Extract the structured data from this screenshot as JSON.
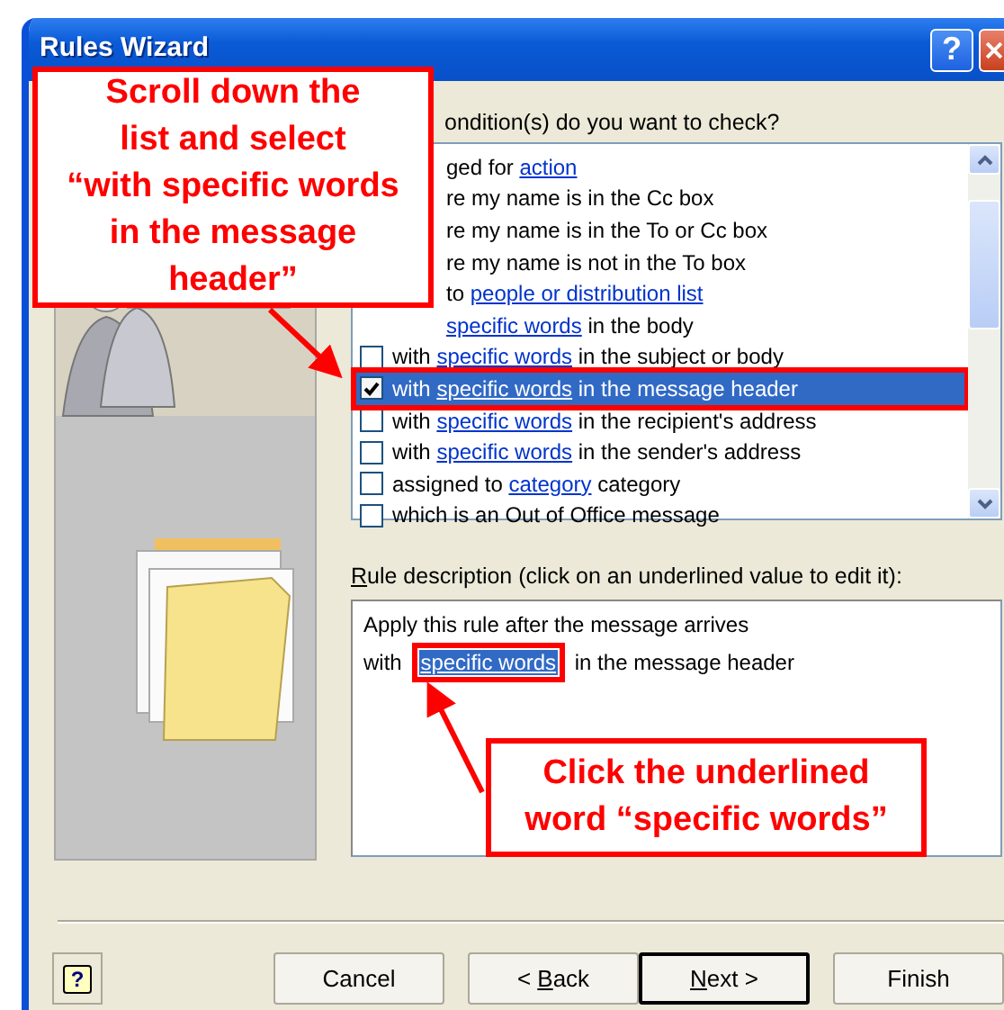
{
  "window": {
    "title": "Rules Wizard",
    "help_glyph": "?"
  },
  "conditions": {
    "label": "ondition(s) do you want to check?",
    "rows": [
      {
        "covered": true,
        "selected": false,
        "annotated": false,
        "segments": [
          {
            "text": "ged for "
          },
          {
            "text": "action",
            "link": true
          }
        ]
      },
      {
        "covered": true,
        "selected": false,
        "annotated": false,
        "segments": [
          {
            "text": "re my name is in the Cc box"
          }
        ]
      },
      {
        "covered": true,
        "selected": false,
        "annotated": false,
        "segments": [
          {
            "text": "re my name is in the To or Cc box"
          }
        ]
      },
      {
        "covered": true,
        "selected": false,
        "annotated": false,
        "segments": [
          {
            "text": "re my name is not in the To box"
          }
        ]
      },
      {
        "covered": true,
        "selected": false,
        "annotated": false,
        "segments": [
          {
            "text": "to "
          },
          {
            "text": "people or distribution list",
            "link": true
          }
        ]
      },
      {
        "covered": true,
        "selected": false,
        "annotated": false,
        "segments": [
          {
            "text": "specific words",
            "link": true
          },
          {
            "text": " in the body"
          }
        ]
      },
      {
        "covered": false,
        "checked": false,
        "selected": false,
        "annotated": false,
        "segments": [
          {
            "text": "with "
          },
          {
            "text": "specific words",
            "link": true
          },
          {
            "text": " in the subject or body"
          }
        ]
      },
      {
        "covered": false,
        "checked": true,
        "selected": true,
        "annotated": true,
        "segments": [
          {
            "text": "with "
          },
          {
            "text": "specific words",
            "link": true
          },
          {
            "text": " in the message header"
          }
        ]
      },
      {
        "covered": false,
        "checked": false,
        "selected": false,
        "annotated": false,
        "segments": [
          {
            "text": "with "
          },
          {
            "text": "specific words",
            "link": true
          },
          {
            "text": " in the recipient's address"
          }
        ]
      },
      {
        "covered": false,
        "checked": false,
        "selected": false,
        "annotated": false,
        "segments": [
          {
            "text": "with "
          },
          {
            "text": "specific words",
            "link": true
          },
          {
            "text": " in the sender's address"
          }
        ]
      },
      {
        "covered": false,
        "checked": false,
        "selected": false,
        "annotated": false,
        "segments": [
          {
            "text": "assigned to "
          },
          {
            "text": "category",
            "link": true
          },
          {
            "text": " category"
          }
        ]
      },
      {
        "covered": false,
        "checked": false,
        "selected": false,
        "annotated": false,
        "segments": [
          {
            "text": "which is an Out of Office message"
          }
        ]
      }
    ]
  },
  "rule_description": {
    "label": {
      "key": "R",
      "rest": "ule description (click on an underlined value to edit it):"
    },
    "lines": [
      [
        {
          "text": "Apply this rule after the message arrives"
        }
      ],
      [
        {
          "text": "with "
        },
        {
          "text": "specific words",
          "link": true,
          "selected": true,
          "annotated": true
        },
        {
          "text": " in the message header"
        }
      ]
    ]
  },
  "buttons": [
    {
      "kind": "help",
      "label": "?"
    },
    {
      "kind": "plain",
      "after": "Cancel",
      "default": false
    },
    {
      "kind": "plain",
      "before": "< ",
      "key": "B",
      "after": "ack",
      "default": false
    },
    {
      "kind": "plain",
      "key": "N",
      "after": "ext >",
      "default": true
    },
    {
      "kind": "plain",
      "after": "Finish",
      "default": false
    }
  ],
  "callouts": [
    {
      "lines": [
        "Scroll down the",
        "list and select",
        "“with specific words",
        "in the message",
        "header”"
      ]
    },
    {
      "lines": [
        "Click the underlined",
        "word “specific words”"
      ]
    }
  ]
}
